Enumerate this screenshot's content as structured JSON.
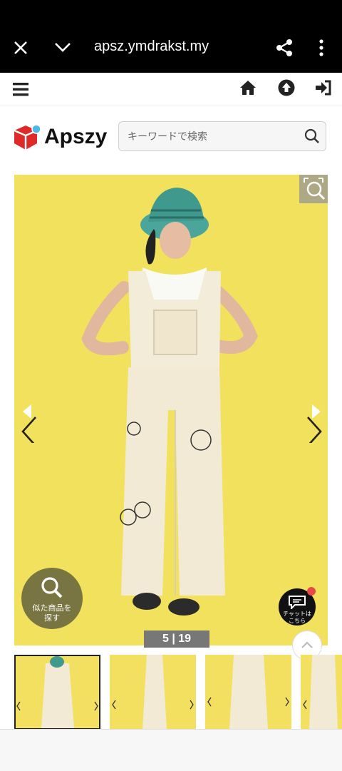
{
  "browser": {
    "url": "apsz.ymdrakst.my",
    "close_icon": "close-icon",
    "dropdown_icon": "chevron-down-icon",
    "share_icon": "share-icon",
    "menu_icon": "more-vertical-icon"
  },
  "site": {
    "logo_text": "Apszy",
    "search_placeholder": "キーワードで検索",
    "nav_icons": [
      "hamburger-menu-icon",
      "home-icon",
      "upload-icon",
      "login-icon"
    ]
  },
  "product": {
    "image_index": "5",
    "image_total": "19",
    "similar_label_line1": "似た商品を",
    "similar_label_line2": "探す",
    "chat_label_line1": "チャットは",
    "chat_label_line2": "こちら",
    "thumbnails": [
      "thumb-front",
      "thumb-side",
      "thumb-back",
      "thumb-partial"
    ]
  },
  "colors": {
    "background_yellow": "#f2e15c",
    "brand_red": "#e02a2a",
    "brand_blue": "#4fb6e8",
    "chat_badge": "#e94848"
  }
}
